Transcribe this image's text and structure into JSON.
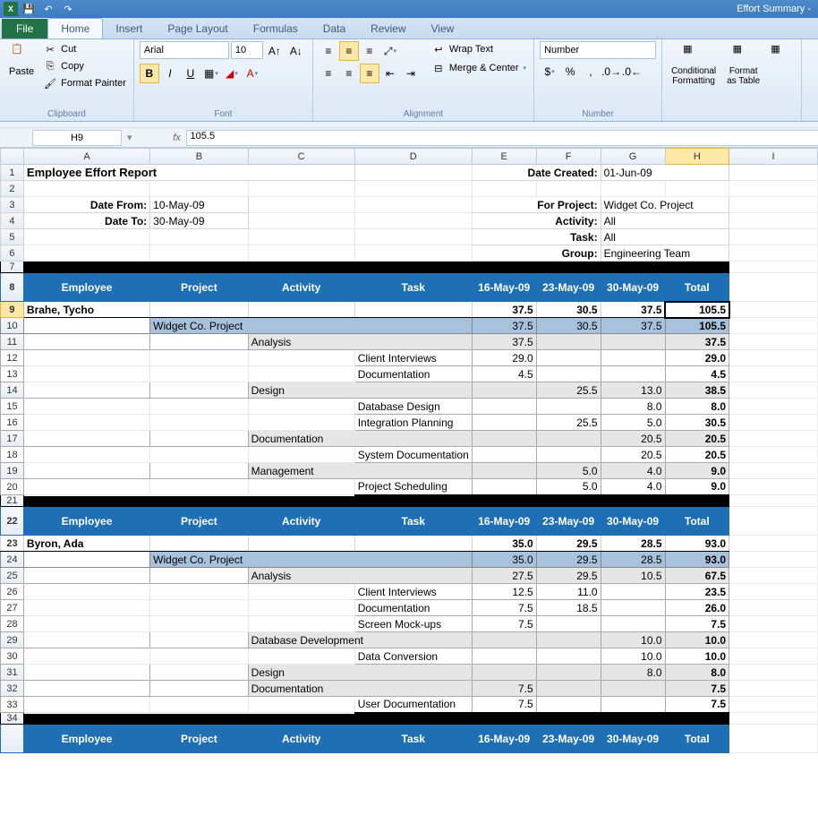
{
  "app": {
    "title": "Effort Summary -"
  },
  "tabs": {
    "file": "File",
    "home": "Home",
    "insert": "Insert",
    "page_layout": "Page Layout",
    "formulas": "Formulas",
    "data": "Data",
    "review": "Review",
    "view": "View"
  },
  "ribbon": {
    "clipboard": {
      "label": "Clipboard",
      "paste": "Paste",
      "cut": "Cut",
      "copy": "Copy",
      "format_painter": "Format Painter"
    },
    "font": {
      "label": "Font",
      "name": "Arial",
      "size": "10"
    },
    "alignment": {
      "label": "Alignment",
      "wrap": "Wrap Text",
      "merge": "Merge & Center"
    },
    "number": {
      "label": "Number",
      "format": "Number"
    },
    "styles": {
      "cond": "Conditional",
      "cond2": "Formatting",
      "table": "Format",
      "table2": "as Table"
    }
  },
  "fxbar": {
    "cellref": "H9",
    "formula": "105.5"
  },
  "cols": [
    "A",
    "B",
    "C",
    "D",
    "E",
    "F",
    "G",
    "H",
    "I"
  ],
  "report": {
    "title": "Employee Effort Report",
    "date_created_lbl": "Date Created:",
    "date_created": "01-Jun-09",
    "date_from_lbl": "Date From:",
    "date_from": "10-May-09",
    "date_to_lbl": "Date To:",
    "date_to": "30-May-09",
    "for_project_lbl": "For Project:",
    "for_project": "Widget Co. Project",
    "activity_lbl": "Activity:",
    "activity": "All",
    "task_lbl": "Task:",
    "task": "All",
    "group_lbl": "Group:",
    "group": "Engineering Team",
    "hdr": {
      "emp": "Employee",
      "proj": "Project",
      "act": "Activity",
      "task": "Task",
      "d1": "16-May-09",
      "d2": "23-May-09",
      "d3": "30-May-09",
      "tot": "Total"
    }
  },
  "emp1": {
    "name": "Brahe, Tycho",
    "d1": "37.5",
    "d2": "30.5",
    "d3": "37.5",
    "tot": "105.5",
    "proj": {
      "name": "Widget Co. Project",
      "d1": "37.5",
      "d2": "30.5",
      "d3": "37.5",
      "tot": "105.5"
    },
    "a1": {
      "name": "Analysis",
      "d1": "37.5",
      "tot": "37.5",
      "t1": {
        "name": "Client Interviews",
        "d1": "29.0",
        "tot": "29.0"
      },
      "t2": {
        "name": "Documentation",
        "d1": "4.5",
        "tot": "4.5"
      }
    },
    "a2": {
      "name": "Design",
      "d2": "25.5",
      "d3": "13.0",
      "tot": "38.5",
      "t1": {
        "name": "Database Design",
        "d3": "8.0",
        "tot": "8.0"
      },
      "t2": {
        "name": "Integration Planning",
        "d2": "25.5",
        "d3": "5.0",
        "tot": "30.5"
      }
    },
    "a3": {
      "name": "Documentation",
      "d3": "20.5",
      "tot": "20.5",
      "t1": {
        "name": "System Documentation",
        "d3": "20.5",
        "tot": "20.5"
      }
    },
    "a4": {
      "name": "Management",
      "d2": "5.0",
      "d3": "4.0",
      "tot": "9.0",
      "t1": {
        "name": "Project Scheduling",
        "d2": "5.0",
        "d3": "4.0",
        "tot": "9.0"
      }
    }
  },
  "emp2": {
    "name": "Byron, Ada",
    "d1": "35.0",
    "d2": "29.5",
    "d3": "28.5",
    "tot": "93.0",
    "proj": {
      "name": "Widget Co. Project",
      "d1": "35.0",
      "d2": "29.5",
      "d3": "28.5",
      "tot": "93.0"
    },
    "a1": {
      "name": "Analysis",
      "d1": "27.5",
      "d2": "29.5",
      "d3": "10.5",
      "tot": "67.5",
      "t1": {
        "name": "Client Interviews",
        "d1": "12.5",
        "d2": "11.0",
        "tot": "23.5"
      },
      "t2": {
        "name": "Documentation",
        "d1": "7.5",
        "d2": "18.5",
        "tot": "26.0"
      },
      "t3": {
        "name": "Screen Mock-ups",
        "d1": "7.5",
        "tot": "7.5"
      }
    },
    "a2": {
      "name": "Database Development",
      "d3": "10.0",
      "tot": "10.0",
      "t1": {
        "name": "Data Conversion",
        "d3": "10.0",
        "tot": "10.0"
      }
    },
    "a3": {
      "name": "Design",
      "d3": "8.0",
      "tot": "8.0"
    },
    "a4": {
      "name": "Documentation",
      "d1": "7.5",
      "tot": "7.5",
      "t1": {
        "name": "User Documentation",
        "d1": "7.5",
        "tot": "7.5"
      }
    }
  }
}
